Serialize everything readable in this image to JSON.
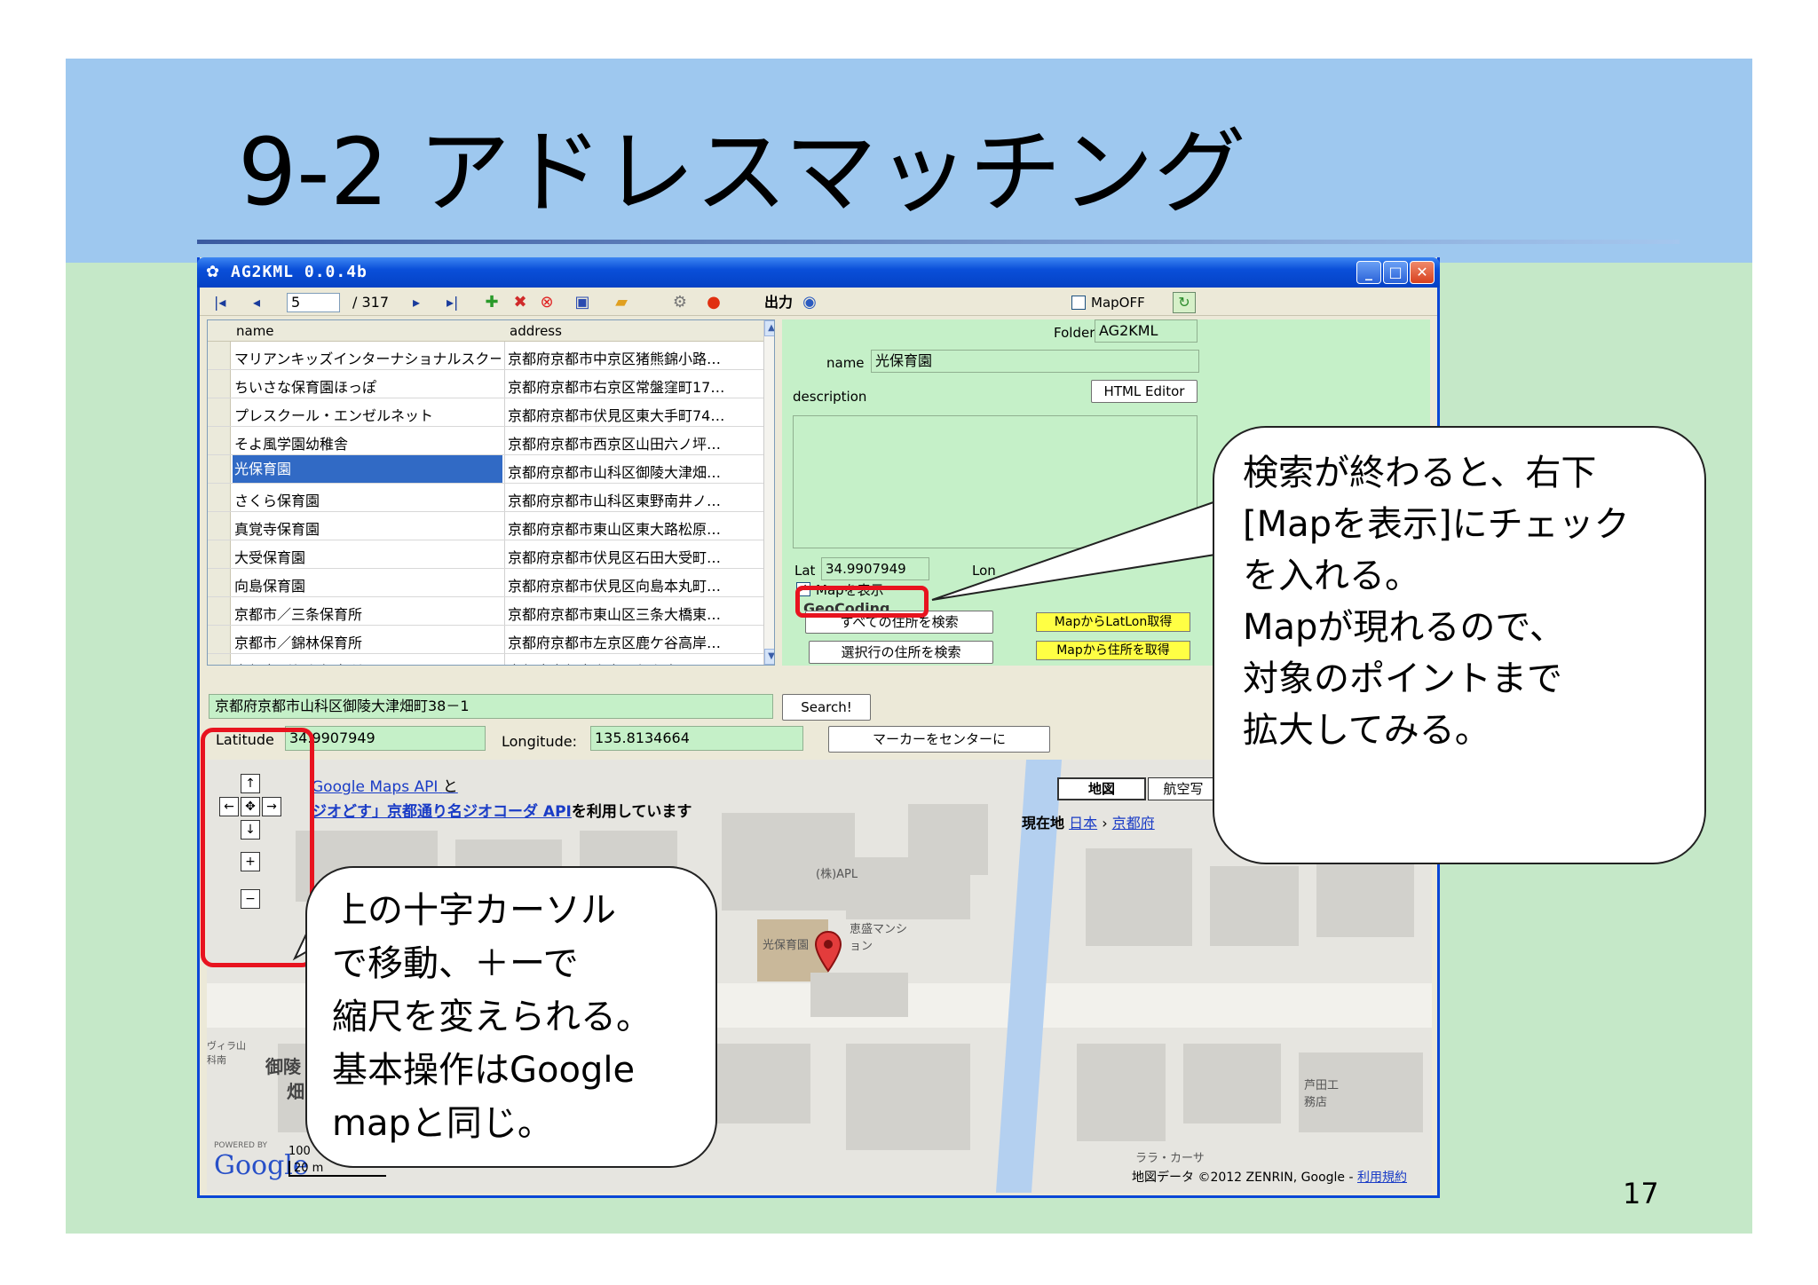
{
  "slide": {
    "title": "9-2 アドレスマッチング",
    "page_number": "17"
  },
  "window": {
    "title": "AG2KML 0.0.4b",
    "controls": {
      "minimize": "_",
      "maximize": "□",
      "close": "✕"
    }
  },
  "toolbar": {
    "first_icon": "|◂",
    "prev_icon": "◂",
    "record": "5",
    "total": "/ 317",
    "next_icon": "▸",
    "last_icon": "▸|",
    "output_label": "出力",
    "mapoff_label": "MapOFF"
  },
  "table": {
    "headers": {
      "name": "name",
      "address": "address"
    },
    "rows": [
      {
        "name": "マリアンキッズインターナショナルスクール",
        "address": "京都府京都市中京区猪熊錦小路…"
      },
      {
        "name": "ちいさな保育園ほっぽ",
        "address": "京都府京都市右京区常盤窪町17…"
      },
      {
        "name": "プレスクール・エンゼルネット",
        "address": "京都府京都市伏見区東大手町74…"
      },
      {
        "name": "そよ風学園幼稚舎",
        "address": "京都府京都市西京区山田六ノ坪…"
      },
      {
        "name": "光保育園",
        "address": "京都府京都市山科区御陵大津畑…"
      },
      {
        "name": "さくら保育園",
        "address": "京都府京都市山科区東野南井ノ…"
      },
      {
        "name": "真覚寺保育園",
        "address": "京都府京都市東山区東大路松原…"
      },
      {
        "name": "大受保育園",
        "address": "京都府京都市伏見区石田大受町…"
      },
      {
        "name": "向島保育園",
        "address": "京都府京都市伏見区向島本丸町…"
      },
      {
        "name": "京都市／三条保育所",
        "address": "京都府京都市東山区三条大橋東…"
      },
      {
        "name": "京都市／錦林保育所",
        "address": "京都府京都市左京区鹿ケ谷高岸…"
      },
      {
        "name": "京都市／仁和保育所",
        "address": "京都府京都市上京区仁和寺…"
      }
    ]
  },
  "details": {
    "folder_label": "Folder",
    "folder_value": "AG2KML",
    "name_label": "name",
    "name_value": "光保育園",
    "description_label": "description",
    "html_editor": "HTML Editor",
    "lat_label": "Lat",
    "lat_value": "34.9907949",
    "lon_label": "Lon",
    "map_display_label": "Mapを表示",
    "geocoding_label": "GeoCoding",
    "search_all": "すべての住所を検索",
    "search_selected": "選択行の住所を検索",
    "get_latlon": "MapからLatLon取得",
    "get_address": "Mapから住所を取得"
  },
  "search": {
    "address": "京都府京都市山科区御陵大津畑町38－1",
    "button": "Search!",
    "latitude_label": "Latitude",
    "latitude_value": "34.9907949",
    "longitude_label": "Longitude:",
    "longitude_value": "135.8134664",
    "center_button": "マーカーをセンターに"
  },
  "map": {
    "api_link": "Google Maps API",
    "api_and": "と",
    "geocoder_link": "ジオどす」京都通り名ジオコーダ API",
    "geocoder_suffix": "を利用しています",
    "maptype_map": "地図",
    "maptype_aerial": "航空写",
    "location_label": "現在地",
    "crumb_japan": "日本",
    "crumb_kyoto": "京都府",
    "label_apl": "(株)APL",
    "label_hikari": "光保育園",
    "label_mansion": "恵盛マンション",
    "label_misasagi": "御陵",
    "label_hata": "畑",
    "label_villa": "ヴィラ山科南",
    "label_shop": "芦田工務店",
    "label_lala": "ララ・カーサ",
    "powered_by": "POWERED BY",
    "google": "Google",
    "scale_top": "100",
    "scale_bottom": "20 m",
    "copyright": "地図データ ©2012 ZENRIN, Google - ",
    "terms": "利用規約"
  },
  "callouts": {
    "right": [
      "検索が終わると、右下",
      "[Mapを表示]にチェック",
      "を入れる。",
      "Mapが現れるので、",
      "対象のポイントまで",
      "拡大してみる。"
    ],
    "left": [
      "上の十字カーソル",
      "で移動、＋ーで",
      "縮尺を変えられる。",
      "基本操作はGoogle",
      "mapと同じ。"
    ]
  },
  "colors": {
    "slide_blue": "#9ec8ef",
    "slide_green": "#c5e8c8",
    "highlight_red": "#e8131f",
    "selection_blue": "#316ac5"
  }
}
